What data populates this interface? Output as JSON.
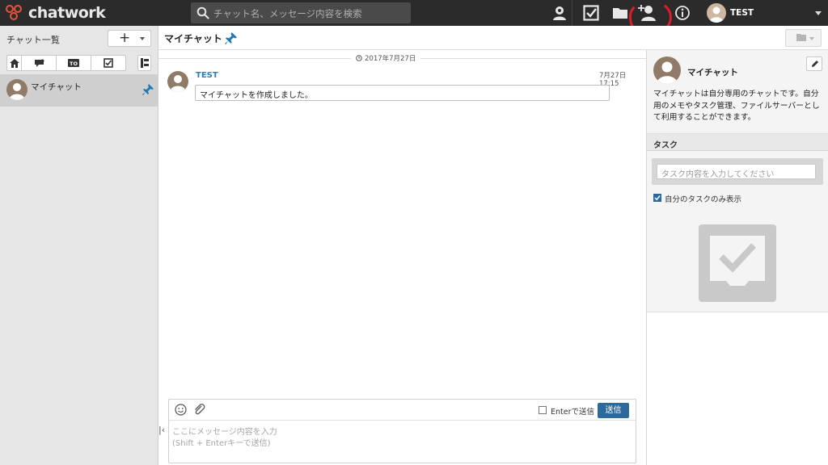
{
  "app": {
    "logo_text": "chatwork",
    "search_placeholder": "チャット名、メッセージ内容を検索",
    "username": "TEST"
  },
  "sidebar": {
    "title": "チャット一覧",
    "add_label": "+",
    "chats": [
      {
        "name": "マイチャット",
        "pinned": true
      }
    ]
  },
  "chat": {
    "title": "マイチャット",
    "date_label": "2017年7月27日",
    "messages": [
      {
        "author": "TEST",
        "time": "7月27日 17:15",
        "body": "マイチャットを作成しました。"
      }
    ],
    "composer": {
      "enter_to_send_label": "Enterで送信",
      "send_label": "送信",
      "placeholder_line1": "ここにメッセージ内容を入力",
      "placeholder_line2": "(Shift + Enterキーで送信)"
    }
  },
  "panel": {
    "room_name": "マイチャット",
    "description": "マイチャットは自分専用のチャットです。自分用のメモやタスク管理、ファイルサーバーとして利用することができます。",
    "task_header": "タスク",
    "task_placeholder": "タスク内容を入力してください",
    "only_mine_label": "自分のタスクのみ表示",
    "only_mine_checked": true
  },
  "colors": {
    "topbar": "#2b2b2b",
    "accent": "#2c6a9e",
    "logo": "#e8533b",
    "annotation": "#e01b2b"
  }
}
